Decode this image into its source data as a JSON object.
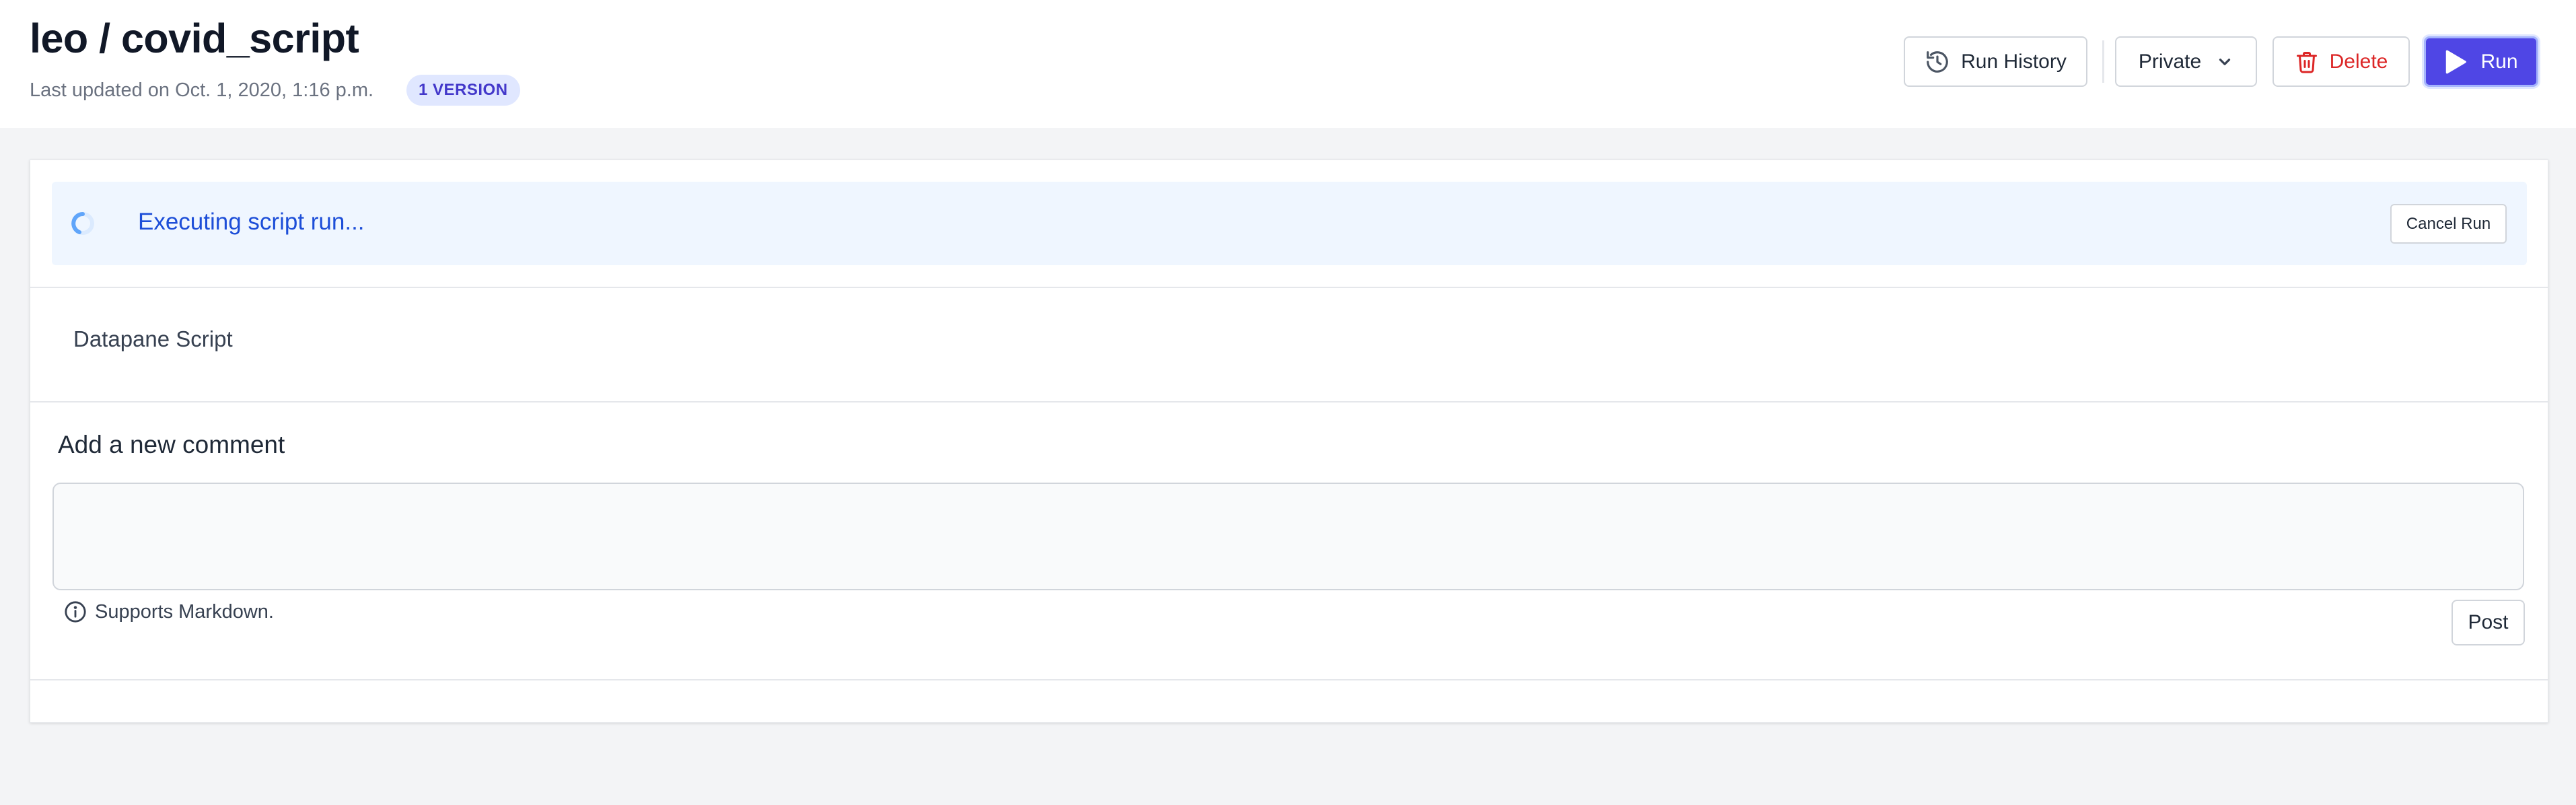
{
  "header": {
    "owner": "leo",
    "separator": "/",
    "script_name": "covid_script",
    "last_updated": "Last updated on Oct. 1, 2020, 1:16 p.m.",
    "version_badge": "1 VERSION"
  },
  "toolbar": {
    "run_history_label": "Run History",
    "visibility_label": "Private",
    "delete_label": "Delete",
    "run_label": "Run"
  },
  "run_status": {
    "message": "Executing script run...",
    "cancel_label": "Cancel Run"
  },
  "script": {
    "label": "Datapane Script"
  },
  "comments": {
    "title": "Add a new comment",
    "input_value": "",
    "note": "Supports Markdown.",
    "post_label": "Post"
  },
  "colors": {
    "primary": "#4f46e5",
    "danger": "#dc2626",
    "info_bg": "#eff6ff",
    "info_text": "#1d4ed8",
    "badge_bg": "#e0e7ff",
    "page_bg": "#f3f4f6"
  },
  "icons": {
    "run_history": "history-icon",
    "visibility": "chevron-down-icon",
    "delete": "trash-icon",
    "run": "play-icon",
    "status": "spinner-icon",
    "note": "info-icon"
  }
}
